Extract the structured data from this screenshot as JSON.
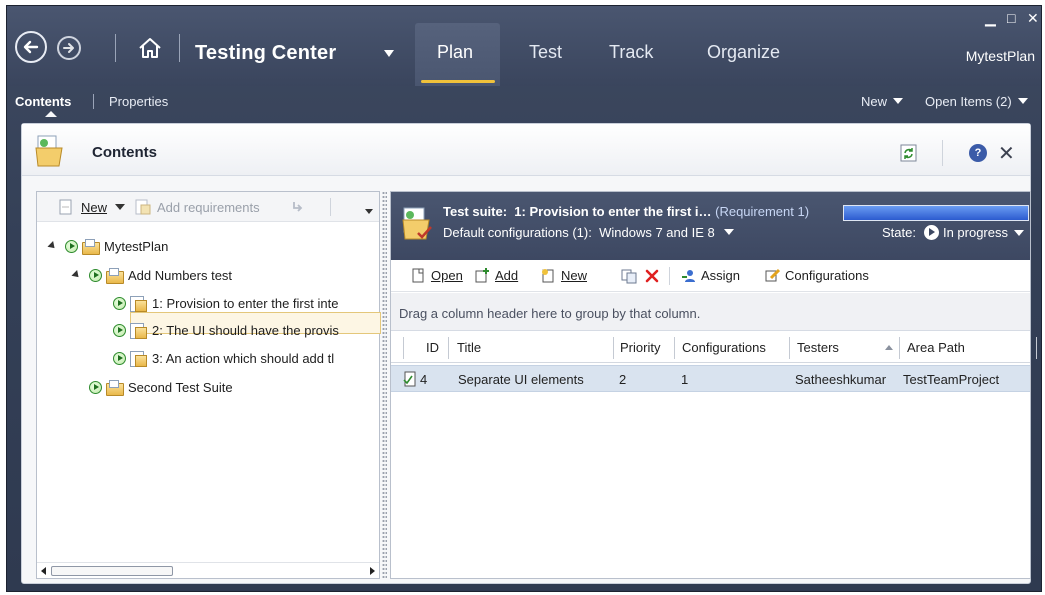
{
  "window": {
    "title": "Testing Center",
    "plan_name": "MytestPlan",
    "minimize_glyph": "▁",
    "maximize_glyph": "□",
    "close_glyph": "✕"
  },
  "tabs": [
    {
      "label": "Plan",
      "active": true
    },
    {
      "label": "Test"
    },
    {
      "label": "Track"
    },
    {
      "label": "Organize"
    }
  ],
  "subnav": {
    "contents": "Contents",
    "properties": "Properties",
    "new": "New",
    "open_items": "Open Items (2)"
  },
  "panel": {
    "title": "Contents"
  },
  "left_toolbar": {
    "new": "New",
    "add_requirements": "Add requirements"
  },
  "tree": {
    "root": "MytestPlan",
    "suite1": "Add Numbers test",
    "req1": "1: Provision to enter the first inte",
    "req2": "2: The UI should have the provis",
    "req3": "3: An action which should add tl",
    "suite2": "Second Test Suite"
  },
  "suite": {
    "label": "Test suite:",
    "name": "1: Provision to enter the first i…",
    "requirement": "(Requirement 1)",
    "default_configs": "Default configurations (1):",
    "config_value": "Windows 7 and IE 8",
    "state_label": "State:",
    "state_value": "In progress"
  },
  "right_toolbar": {
    "open": "Open",
    "add": "Add",
    "new": "New",
    "assign": "Assign",
    "configurations": "Configurations"
  },
  "group_hint": "Drag a column header here to group by that column.",
  "columns": {
    "id": "ID",
    "title": "Title",
    "priority": "Priority",
    "configurations": "Configurations",
    "testers": "Testers",
    "area_path": "Area Path"
  },
  "rows": [
    {
      "id": "4",
      "title": "Separate UI elements",
      "priority": "2",
      "configurations": "1",
      "testers": "Satheeshkumar",
      "area_path": "TestTeamProject"
    }
  ],
  "colors": {
    "chrome": "#3a455d",
    "accent": "#f0c23b",
    "progress": "#2c5bcf",
    "row_selected": "#d9e3ef"
  }
}
